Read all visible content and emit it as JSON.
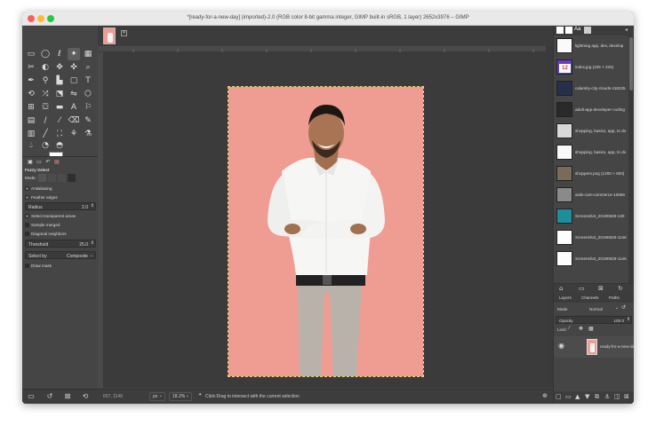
{
  "window": {
    "title": "*[ready-for-a-new-day] (imported)-2.0 (RGB color 8-bit gamma integer, GIMP built-in sRGB, 1 layer) 2652x3976 – GIMP"
  },
  "tool_options": {
    "title": "Fuzzy Select",
    "mode_label": "Mode:",
    "antialiasing": "Antialiasing",
    "feather_edges": "Feather edges",
    "radius_label": "Radius",
    "radius_value": "2.0",
    "select_transparent": "Select transparent areas",
    "sample_merged": "Sample merged",
    "diagonal_neighbors": "Diagonal neighbors",
    "threshold_label": "Threshold",
    "threshold_value": "25.0",
    "select_by_label": "Select by",
    "select_by_value": "Composite",
    "draw_mask": "Draw mask"
  },
  "statusbar": {
    "coords": "657, 1149",
    "unit": "px",
    "zoom": "18.2%",
    "message": "Click-Drag to intersect with the current selection"
  },
  "images_panel": {
    "items": [
      {
        "name": "lightning app, dev, develop"
      },
      {
        "name": "index.jpg (225 × 225)",
        "badge": "12"
      },
      {
        "name": "calamity-city-clouds-116225"
      },
      {
        "name": "adult-app-developer-coding"
      },
      {
        "name": "shopping, basics, app, to do"
      },
      {
        "name": "shopping, basics, app, to do"
      },
      {
        "name": "shoppers.png (1200 × 600)"
      },
      {
        "name": "aisle-cart-commerce-10556"
      },
      {
        "name": "Screenshot_20190628-130"
      },
      {
        "name": "Screenshot_20190628-1146"
      },
      {
        "name": "Screenshot_20190628-1146"
      }
    ]
  },
  "layers_panel": {
    "tabs": [
      "Layers",
      "Channels",
      "Paths"
    ],
    "mode_label": "Mode",
    "mode_value": "Normal",
    "opacity_label": "Opacity",
    "opacity_value": "100.0",
    "lock_label": "Lock:",
    "layer_name": "ready-for-a-new-day"
  },
  "colors": {
    "photo_bg": "#ef9c92",
    "dock_bg": "#454545",
    "canvas_bg": "#3b3b3b"
  }
}
